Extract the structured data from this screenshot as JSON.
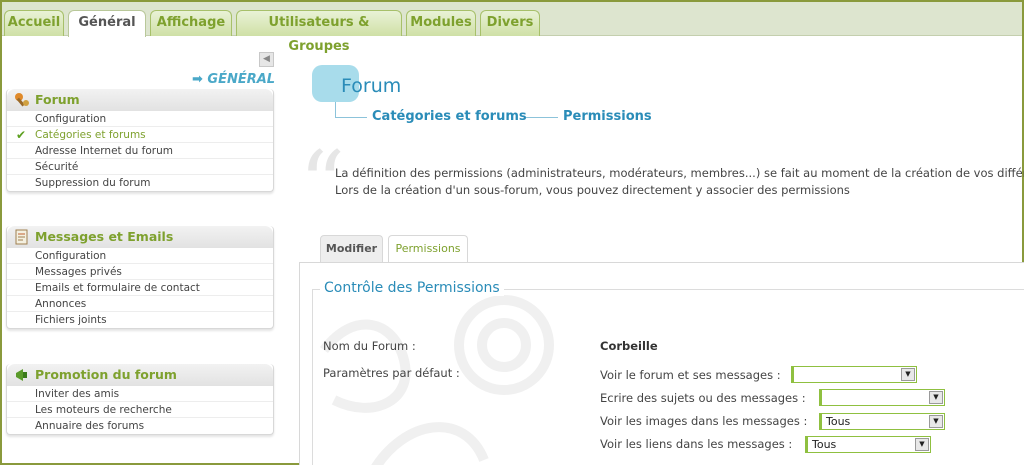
{
  "tabs": [
    {
      "label": "Accueil"
    },
    {
      "label": "Général"
    },
    {
      "label": "Affichage"
    },
    {
      "label": "Utilisateurs & Groupes"
    },
    {
      "label": "Modules"
    },
    {
      "label": "Divers"
    }
  ],
  "sidebar": {
    "section_label": "➡ GÉNÉRAL",
    "panels": [
      {
        "title": "Forum",
        "items": [
          {
            "label": "Configuration"
          },
          {
            "label": "Catégories et forums",
            "active": true
          },
          {
            "label": "Adresse Internet du forum"
          },
          {
            "label": "Sécurité"
          },
          {
            "label": "Suppression du forum"
          }
        ]
      },
      {
        "title": "Messages et Emails",
        "items": [
          {
            "label": "Configuration"
          },
          {
            "label": "Messages privés"
          },
          {
            "label": "Emails et formulaire de contact"
          },
          {
            "label": "Annonces"
          },
          {
            "label": "Fichiers joints"
          }
        ]
      },
      {
        "title": "Promotion du forum",
        "items": [
          {
            "label": "Inviter des amis"
          },
          {
            "label": "Les moteurs de recherche"
          },
          {
            "label": "Annuaire des forums"
          }
        ]
      }
    ]
  },
  "main": {
    "title": "Forum",
    "breadcrumb": [
      "Catégories et forums",
      "Permissions"
    ],
    "description": [
      "La définition des permissions (administrateurs, modérateurs, membres...) se fait au moment de la création de vos différents",
      "Lors de la création d'un sous-forum, vous pouvez directement y associer des permissions"
    ],
    "subtabs": [
      "Modifier",
      "Permissions"
    ],
    "fieldset_title": "Contrôle des Permissions",
    "forum_name_label": "Nom du Forum :",
    "forum_name_value": "Corbeille",
    "defaults_label": "Paramètres par défaut :",
    "permissions": [
      {
        "label": "Voir le forum et ses messages :",
        "value": ""
      },
      {
        "label": "Ecrire des sujets ou des messages :",
        "value": ""
      },
      {
        "label": "Voir les images dans les messages :",
        "value": "Tous"
      },
      {
        "label": "Voir les liens dans les messages :",
        "value": "Tous"
      }
    ]
  },
  "colors": {
    "accent_green": "#7ea12e",
    "accent_blue": "#2a8cb8",
    "frame": "#8a9a3c"
  }
}
